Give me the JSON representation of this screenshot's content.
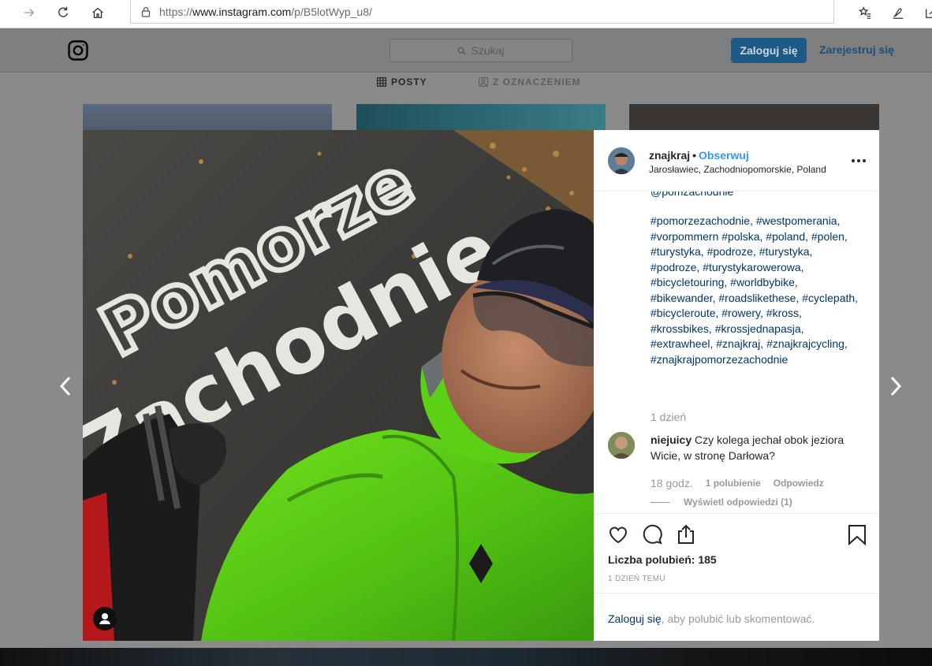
{
  "browser": {
    "url_prefix": "https://",
    "url_host": "www.instagram.com",
    "url_path": "/p/B5lotWyp_u8/"
  },
  "header": {
    "search_placeholder": "Szukaj",
    "login_label": "Zaloguj się",
    "register_label": "Zarejestruj się"
  },
  "tabs": [
    {
      "label": "POSTY",
      "active": true
    },
    {
      "label": "Z OZNACZENIEM",
      "active": false
    }
  ],
  "photo": {
    "sign_line1": "Pomorze",
    "sign_line2": "Zachodnie"
  },
  "post": {
    "username": "znajkraj",
    "separator": "•",
    "follow_label": "Obserwuj",
    "location": "Jarosławiec, Zachodniopomorskie, Poland",
    "caption_cut": "@pomzachodnie",
    "hashtags": "#pomorzezachodnie, #westpomerania, #vorpommern #polska, #poland, #polen, #turystyka, #podroze, #turystyka, #podroze, #turystykarowerowa, #bicycletouring, #worldbybike, #bikewander, #roadslikethese, #cyclepath, #bicycleroute, #rowery, #kross, #krossbikes, #krossjednapasja, #extrawheel, #znajkraj, #znajkrajcycling, #znajkrajpomorzezachodnie",
    "caption_time": "1 dzień",
    "likes_label": "Liczba polubień: 185",
    "date_label": "1 DZIEŃ TEMU"
  },
  "comment": {
    "username": "niejuicy",
    "text": "Czy kolega jechał obok jeziora Wicie, w stronę Darłowa?",
    "time": "18 godz.",
    "likes": "1 polubienie",
    "reply_label": "Odpowiedz",
    "view_replies": "Wyświetl odpowiedzi (1)"
  },
  "login_prompt": {
    "link": "Zaloguj się",
    "rest": ", aby polubić lub skomentować."
  },
  "colors": {
    "link_blue": "#3897f0",
    "hashtag_blue": "#003569",
    "jacket_green": "#5fd117"
  }
}
